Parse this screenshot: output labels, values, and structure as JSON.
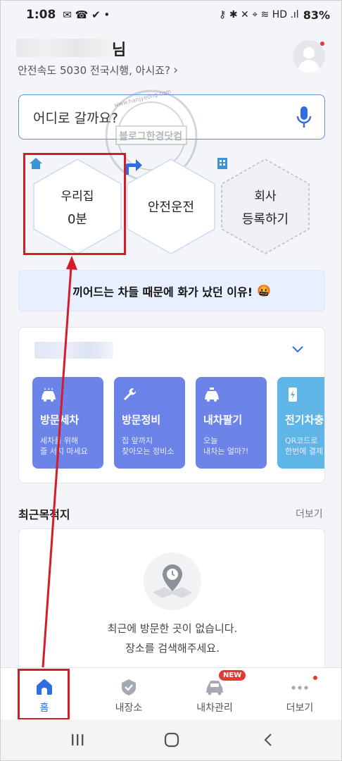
{
  "status_bar": {
    "time": "1:08",
    "left_glyphs": "✉ ☎ ✔ •",
    "right_glyphs": "⚷ ✱ ✕ ⌖ ≋ HD .ıl",
    "battery": "83%"
  },
  "header": {
    "name_suffix": "님",
    "subtitle": "안전속도 5030 전국시행, 아시죠?",
    "subtitle_chevron": "›"
  },
  "search": {
    "placeholder": "어디로 갈까요?"
  },
  "quick": {
    "home": {
      "title": "우리집",
      "value": "0분"
    },
    "drive": {
      "title": "안전운전"
    },
    "work": {
      "title": "회사",
      "action": "등록하기"
    }
  },
  "banner": {
    "text": "끼어드는 차들 때문에 화가 났던 이유!",
    "emoji": "🤬"
  },
  "services": {
    "items": [
      {
        "title": "방문세차",
        "desc1": "세차를 위해",
        "desc2": "줄 서지 마세요"
      },
      {
        "title": "방문정비",
        "desc1": "집 앞까지",
        "desc2": "찾아오는 정비소"
      },
      {
        "title": "내차팔기",
        "desc1": "오늘",
        "desc2": "내차는 얼마?!"
      },
      {
        "title": "전기차충",
        "desc1": "QR코드로",
        "desc2": "한번에 결제"
      }
    ]
  },
  "recent": {
    "title": "최근목적지",
    "more": "더보기",
    "empty_line1": "최근에 방문한 곳이 없습니다.",
    "empty_line2": "장소를 검색해주세요."
  },
  "watermark": {
    "url": "www.hanjyeong.com",
    "text": "블로그한경닷컴"
  },
  "bottom_nav": {
    "items": [
      {
        "label": "홈"
      },
      {
        "label": "내장소"
      },
      {
        "label": "내차관리",
        "badge": "NEW"
      },
      {
        "label": "더보기"
      }
    ]
  },
  "colors": {
    "accent": "#2f6de1",
    "annotation_red": "#d51d2a",
    "tile_blue": "#6c84e8",
    "tile_teal": "#5fb6e6"
  }
}
